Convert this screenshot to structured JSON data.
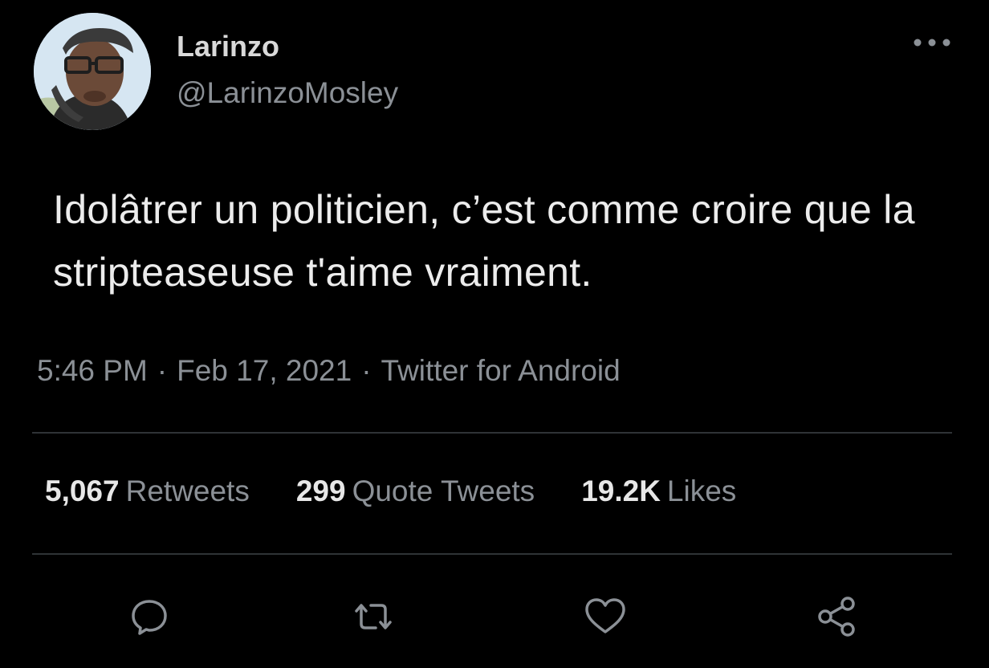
{
  "author": {
    "display_name": "Larinzo",
    "handle": "@LarinzoMosley",
    "avatar_icon": "profile-photo"
  },
  "tweet": {
    "text": "Idolâtrer un politicien, c’est comme croire que la stripteaseuse t'aime vraiment.",
    "time": "5:46 PM",
    "date": "Feb 17, 2021",
    "separator": "·",
    "source": "Twitter for Android"
  },
  "stats": {
    "retweets_count": "5,067",
    "retweets_label": "Retweets",
    "quotes_count": "299",
    "quotes_label": "Quote Tweets",
    "likes_count": "19.2K",
    "likes_label": "Likes"
  },
  "actions": {
    "reply_icon": "speech-bubble-icon",
    "retweet_icon": "retweet-arrows-icon",
    "like_icon": "heart-icon",
    "share_icon": "share-nodes-icon",
    "more_icon": "more-dots-icon"
  },
  "colors": {
    "background": "#000000",
    "primary_text": "#ececec",
    "secondary_text": "#8b9096",
    "divider": "#2f3336"
  }
}
